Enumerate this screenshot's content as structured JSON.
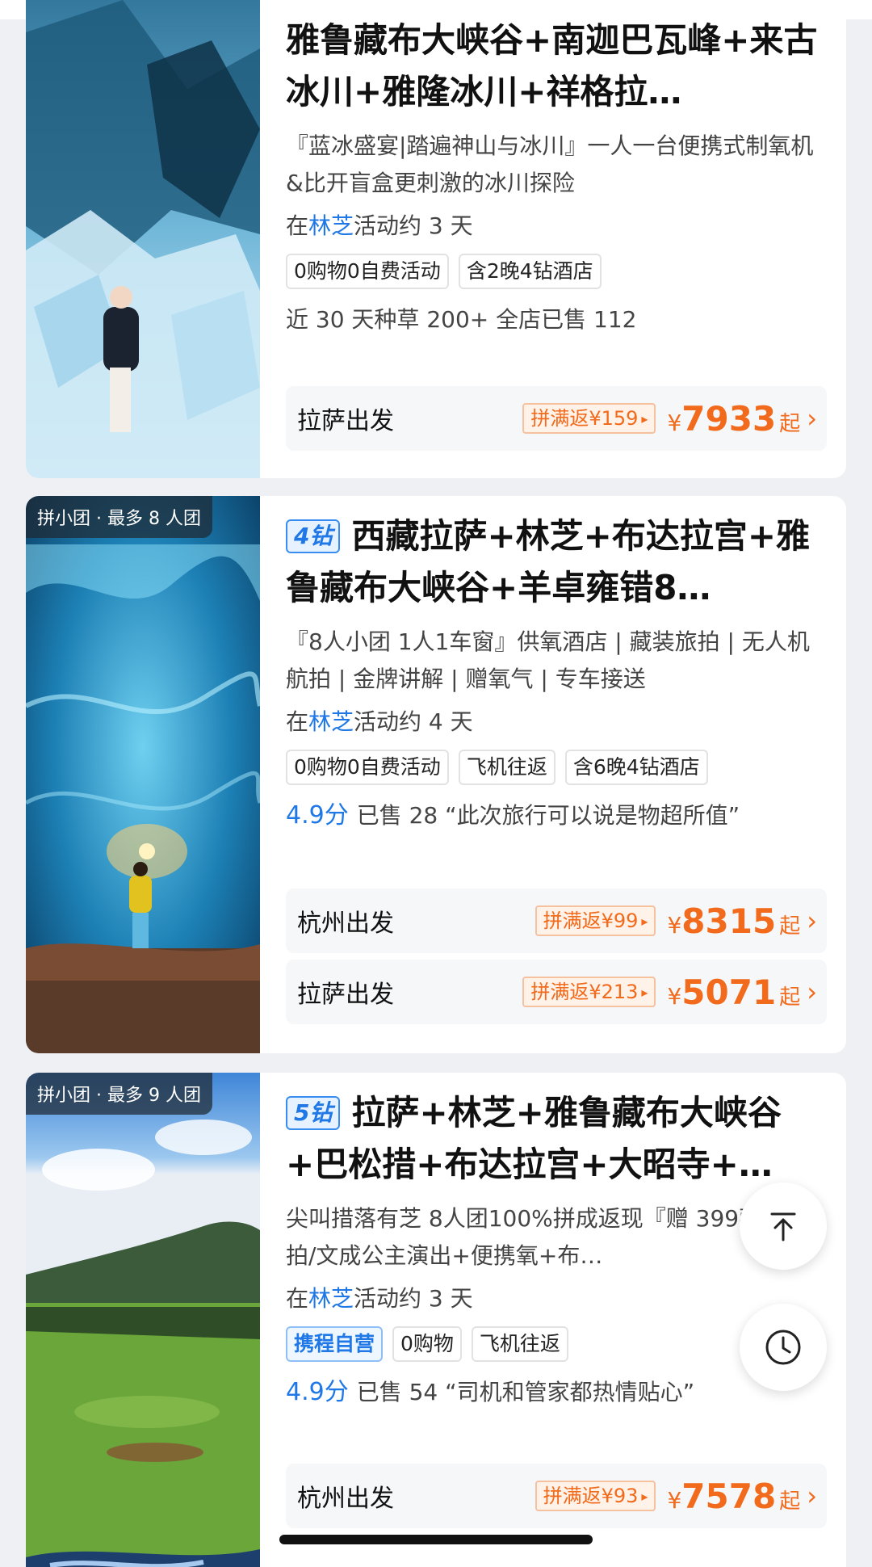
{
  "products": [
    {
      "title": "雅鲁藏布大峡谷+南迦巴瓦峰+来古冰川+雅隆冰川+祥格拉…",
      "desc": "『蓝冰盛宴|踏遍神山与冰川』一人一台便携式制氧机&比开盲盒更刺激的冰川探险",
      "loc_prefix": "在",
      "city": "林芝",
      "loc_suffix": "活动约 3 天",
      "tags": [
        "0购物0自费活动",
        "含2晚4钻酒店"
      ],
      "meta_text": "近 30 天种草 200+ 全店已售 112",
      "departures": [
        {
          "city": "拉萨出发",
          "coupon": "拼满返¥159",
          "yen": "¥",
          "price": "7933",
          "qi": "起"
        }
      ]
    },
    {
      "badge": "拼小团 · 最多 8 人团",
      "diamond": "4钻",
      "title": "西藏拉萨+林芝+布达拉宫+雅鲁藏布大峡谷+羊卓雍错8…",
      "desc": "『8人小团 1人1车窗』供氧酒店 | 藏装旅拍 | 无人机航拍 | 金牌讲解 | 赠氧气 | 专车接送",
      "loc_prefix": "在",
      "city": "林芝",
      "loc_suffix": "活动约 4 天",
      "tags": [
        "0购物0自费活动",
        "飞机往返",
        "含6晚4钻酒店"
      ],
      "score": "4.9分",
      "meta_text": "已售 28 “此次旅行可以说是物超所值”",
      "departures": [
        {
          "city": "杭州出发",
          "coupon": "拼满返¥99",
          "yen": "¥",
          "price": "8315",
          "qi": "起"
        },
        {
          "city": "拉萨出发",
          "coupon": "拼满返¥213",
          "yen": "¥",
          "price": "5071",
          "qi": "起"
        }
      ]
    },
    {
      "badge": "拼小团 · 最多 9 人团",
      "diamond": "5钻",
      "title": "拉萨+林芝+雅鲁藏布大峡谷+巴松措+布达拉宫+大昭寺+…",
      "desc": "尖叫措落有芝 8人团100%拼成返现『赠 399藏装旅拍/文成公主演出+便携氧+布…",
      "loc_prefix": "在",
      "city": "林芝",
      "loc_suffix": "活动约 3 天",
      "ctrip_tag": "携程自营",
      "tags": [
        "0购物",
        "飞机往返"
      ],
      "score": "4.9分",
      "meta_text": "已售 54 “司机和管家都热情贴心”",
      "departures": [
        {
          "city": "杭州出发",
          "coupon": "拼满返¥93",
          "yen": "¥",
          "price": "7578",
          "qi": "起"
        }
      ]
    }
  ],
  "icons": {
    "back_to_top": "arrow-up-icon",
    "history": "clock-icon",
    "chevron": "›",
    "triangle": "▸"
  },
  "colors": {
    "accent_blue": "#1f78e6",
    "price_orange": "#f26a1b",
    "page_bg": "#eef0f4"
  }
}
